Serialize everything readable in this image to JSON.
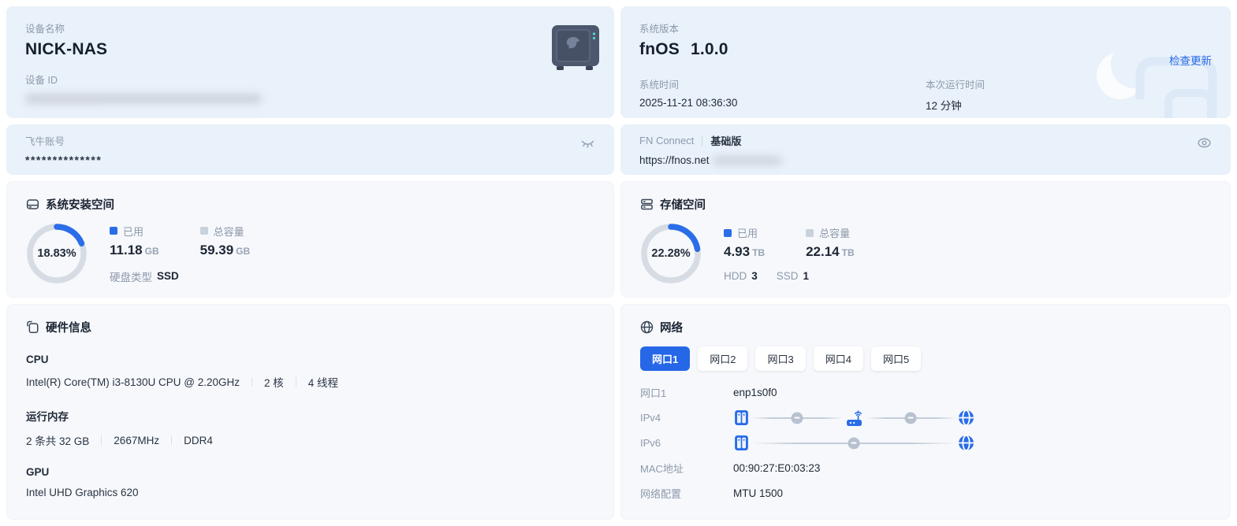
{
  "colors": {
    "accent": "#2667e8",
    "link": "#2b6de8",
    "card_blue": "#e9f1fa",
    "card_grey": "#f6f8fb",
    "donut_track": "#d7dce4",
    "status_dot": "#b7c1cf"
  },
  "device_card": {
    "name_label": "设备名称",
    "name": "NICK-NAS",
    "id_label": "设备 ID"
  },
  "version_card": {
    "label": "系统版本",
    "os_name": "fnOS",
    "os_version": "1.0.0",
    "check_update": "检查更新",
    "time_label": "系统时间",
    "time": "2025-11-21 08:36:30",
    "uptime_label": "本次运行时间",
    "uptime": "12 分钟"
  },
  "account_card": {
    "label": "飞牛账号",
    "masked_value": "**************"
  },
  "connect_card": {
    "brand": "FN Connect",
    "plan": "基础版",
    "url_prefix": "https://fnos.net"
  },
  "system_space_card": {
    "title": "系统安装空间",
    "percent_label": "18.83%",
    "percent": 18.83,
    "used_label": "已用",
    "used_value": "11.18",
    "used_unit": "GB",
    "total_label": "总容量",
    "total_value": "59.39",
    "total_unit": "GB",
    "disk_type_label": "硬盘类型",
    "disk_type": "SSD"
  },
  "storage_card": {
    "title": "存储空间",
    "percent_label": "22.28%",
    "percent": 22.28,
    "used_label": "已用",
    "used_value": "4.93",
    "used_unit": "TB",
    "total_label": "总容量",
    "total_value": "22.14",
    "total_unit": "TB",
    "hdd_label": "HDD",
    "hdd_count": "3",
    "ssd_label": "SSD",
    "ssd_count": "1"
  },
  "hardware_card": {
    "title": "硬件信息",
    "sections": [
      {
        "heading": "CPU",
        "specs": [
          "Intel(R) Core(TM) i3-8130U CPU @ 2.20GHz",
          "2 核",
          "4 线程"
        ]
      },
      {
        "heading": "运行内存",
        "specs": [
          "2 条共 32 GB",
          "2667MHz",
          "DDR4"
        ]
      },
      {
        "heading": "GPU",
        "specs": [
          "Intel UHD Graphics 620"
        ]
      }
    ]
  },
  "network_card": {
    "title": "网络",
    "tabs": [
      "网口1",
      "网口2",
      "网口3",
      "网口4",
      "网口5"
    ],
    "active_tab": "网口1",
    "port_label": "网口1",
    "port_value": "enp1s0f0",
    "ipv4_label": "IPv4",
    "ipv6_label": "IPv6",
    "mac_label": "MAC地址",
    "mac_value": "00:90:27:E0:03:23",
    "config_label": "网络配置",
    "config_value": "MTU 1500"
  }
}
